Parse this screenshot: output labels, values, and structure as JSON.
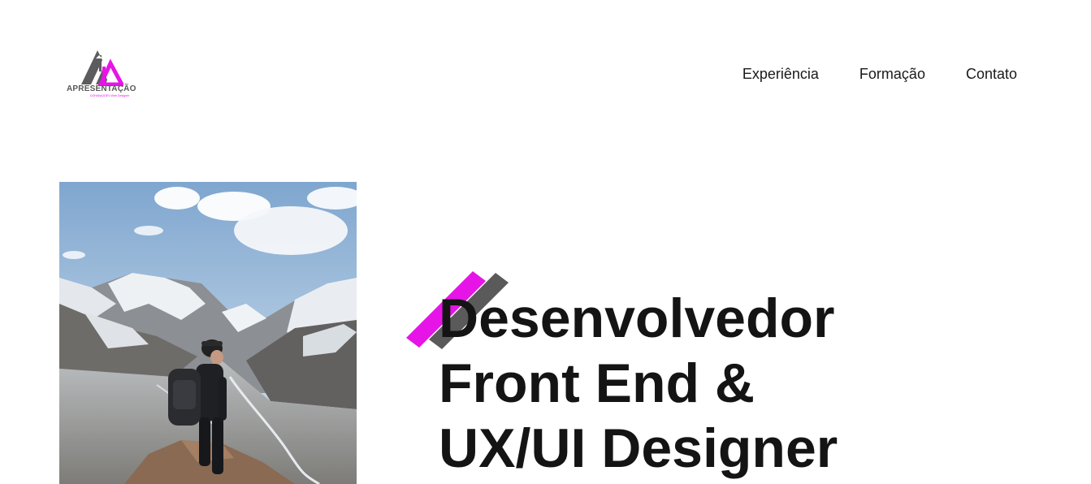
{
  "header": {
    "logo": {
      "title": "APRESENTAÇÃO",
      "subtitle": "DOHANAJDEV Web Designer",
      "colors": {
        "gray": "#58585a",
        "magenta": "#e614e6"
      }
    },
    "nav": [
      {
        "label": "Experiência"
      },
      {
        "label": "Formação"
      },
      {
        "label": "Contato"
      }
    ]
  },
  "hero": {
    "photo_icon": "hiker-mountain-photo",
    "headline_lines": [
      "Desenvolvedor",
      "Front End &",
      "UX/UI Designer"
    ],
    "accent_colors": {
      "magenta": "#e614e6",
      "gray": "#5a5a5a"
    }
  }
}
